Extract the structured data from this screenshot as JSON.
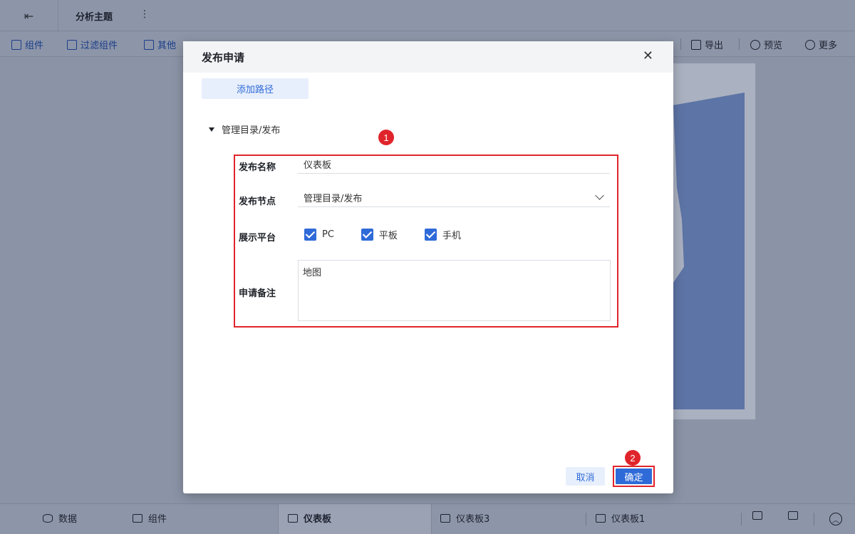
{
  "header": {
    "exit_icon": "exit-icon",
    "title": "分析主题",
    "more_icon": "vertical-dots-icon"
  },
  "toolbar": {
    "left_items": [
      {
        "label": "组件",
        "icon": "component-icon"
      },
      {
        "label": "过滤组件",
        "icon": "filter-component-icon"
      },
      {
        "label": "其他",
        "icon": "other-icon"
      }
    ],
    "right_items": [
      {
        "label": "导出",
        "icon": "export-icon"
      },
      {
        "label": "预览",
        "icon": "preview-icon"
      },
      {
        "label": "更多",
        "icon": "more-icon"
      }
    ]
  },
  "bottom_tabs": {
    "items": [
      {
        "label": "数据",
        "icon": "database-icon"
      },
      {
        "label": "组件",
        "icon": "chart-icon"
      },
      {
        "label": "仪表板",
        "icon": "dashboard-icon",
        "active": true
      },
      {
        "label": "仪表板3",
        "icon": "dashboard-icon"
      },
      {
        "label": "仪表板1",
        "icon": "dashboard-icon"
      }
    ],
    "add_dashboard_icon": "add-dashboard-icon",
    "add_component_icon": "add-component-icon",
    "collapse_icon": "collapse-up-icon"
  },
  "dialog": {
    "title": "发布申请",
    "close_icon": "close-icon",
    "add_path_label": "添加路径",
    "tree_node_label": "管理目录/发布",
    "badge_1": "1",
    "badge_2": "2",
    "form": {
      "name_label": "发布名称",
      "name_value": "仪表板",
      "node_label": "发布节点",
      "node_value": "管理目录/发布",
      "platform_label": "展示平台",
      "platforms": [
        {
          "label": "PC",
          "checked": true
        },
        {
          "label": "平板",
          "checked": true
        },
        {
          "label": "手机",
          "checked": true
        }
      ],
      "note_label": "申请备注",
      "note_value": "地图"
    },
    "cancel_label": "取消",
    "confirm_label": "确定"
  },
  "colors": {
    "accent": "#2f6bd8",
    "highlight_red": "#e0242b",
    "overlay": "#8a93a6"
  }
}
